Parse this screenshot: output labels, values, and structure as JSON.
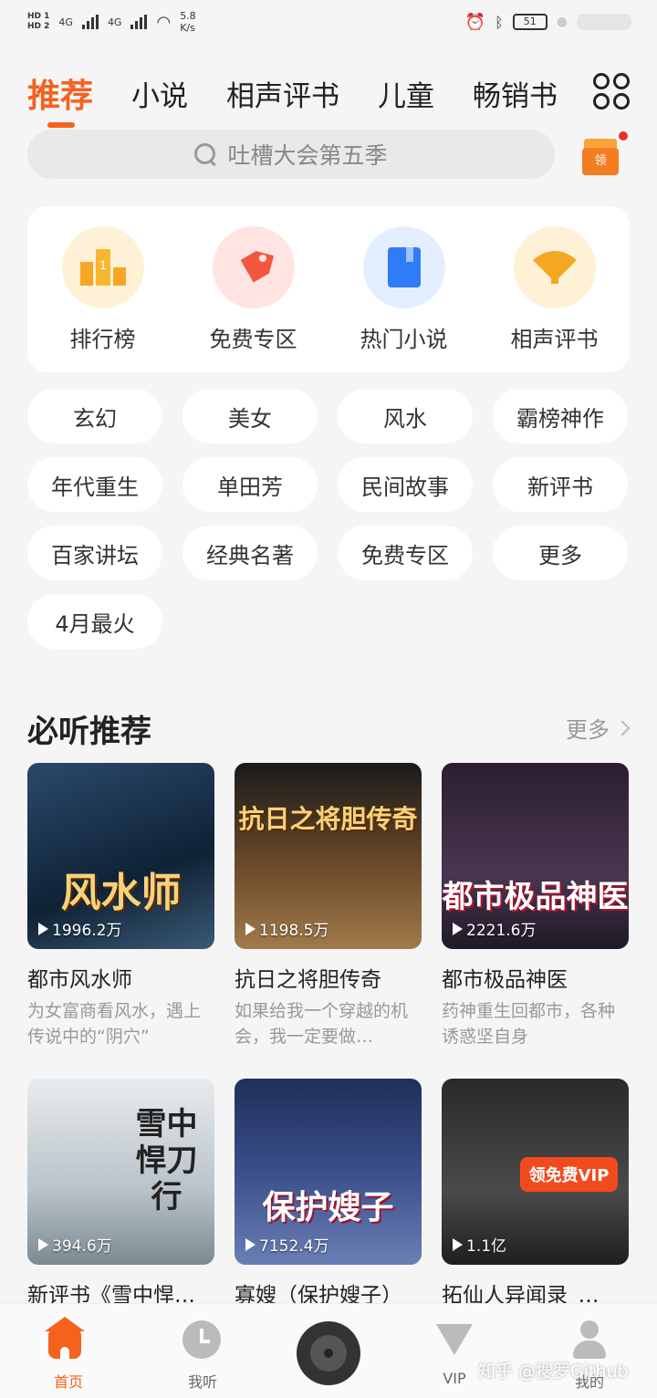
{
  "status_bar": {
    "hd1": "HD 1",
    "hd2": "HD 2",
    "sig1": "4G",
    "sig2": "4G",
    "speed": "5.8",
    "speed_unit": "K/s",
    "battery": "51"
  },
  "tabs": [
    {
      "label": "推荐",
      "active": true
    },
    {
      "label": "小说"
    },
    {
      "label": "相声评书"
    },
    {
      "label": "儿童"
    },
    {
      "label": "畅销书"
    }
  ],
  "search": {
    "placeholder": "吐槽大会第五季"
  },
  "gift": {
    "label": "领"
  },
  "categories": [
    {
      "label": "排行榜",
      "icon": "ranking-icon",
      "bg": "#fff1d6",
      "color": "#f5a623"
    },
    {
      "label": "免费专区",
      "icon": "tag-icon",
      "bg": "#ffe4e1",
      "color": "#f2583e"
    },
    {
      "label": "热门小说",
      "icon": "book-icon",
      "bg": "#e3efff",
      "color": "#2f7cf6"
    },
    {
      "label": "相声评书",
      "icon": "fan-icon",
      "bg": "#fff1d6",
      "color": "#f5a623"
    }
  ],
  "tags": [
    "玄幻",
    "美女",
    "风水",
    "霸榜神作",
    "年代重生",
    "单田芳",
    "民间故事",
    "新评书",
    "百家讲坛",
    "经典名著",
    "免费专区",
    "更多",
    "4月最火"
  ],
  "section": {
    "title": "必听推荐",
    "more": "更多"
  },
  "books": [
    {
      "title": "都市风水师",
      "desc": "为女富商看风水，遇上传说中的“阴穴”",
      "plays": "1996.2万",
      "cover_text": "风水师",
      "cover_bg": "linear-gradient(160deg,#2a4a6b,#0f2236 60%,#3a5a75)"
    },
    {
      "title": "抗日之将胆传奇",
      "desc": "如果给我一个穿越的机会，我一定要做…",
      "plays": "1198.5万",
      "cover_text": "抗日之将胆传奇",
      "cover_bg": "linear-gradient(180deg,#1a1a1a,#6b4a2a 55%,#a07a4a)"
    },
    {
      "title": "都市极品神医",
      "desc": "药神重生回都市，各种诱惑坚自身",
      "plays": "2221.6万",
      "cover_text": "都市极品神医",
      "cover_bg": "linear-gradient(180deg,#2a1f2f,#4a3550 60%,#1f1a26)"
    },
    {
      "title": "新评书《雪中悍…",
      "desc": "",
      "plays": "394.6万",
      "cover_text": "雪中悍刀行",
      "cover_bg": "linear-gradient(180deg,#e8ecef,#b8c2c8 60%,#7d8a92)"
    },
    {
      "title": "寡嫂（保护嫂子）",
      "desc": "",
      "plays": "7152.4万",
      "cover_text": "保护嫂子",
      "cover_bg": "linear-gradient(180deg,#1f2f5a,#3a4f8a 50%,#6a7fb5)"
    },
    {
      "title": "拓仙人异闻录_…",
      "desc": "",
      "plays": "1.1亿",
      "cover_text": "领免费VIP",
      "cover_bg": "linear-gradient(180deg,#2a2a2a,#4a4a4a 60%,#1f1f1f)"
    }
  ],
  "bottom_nav": [
    {
      "label": "首页",
      "active": true
    },
    {
      "label": "我听"
    },
    {
      "label": "VIP"
    },
    {
      "label": "我的"
    }
  ],
  "watermark": "知乎 @搜罗Github"
}
